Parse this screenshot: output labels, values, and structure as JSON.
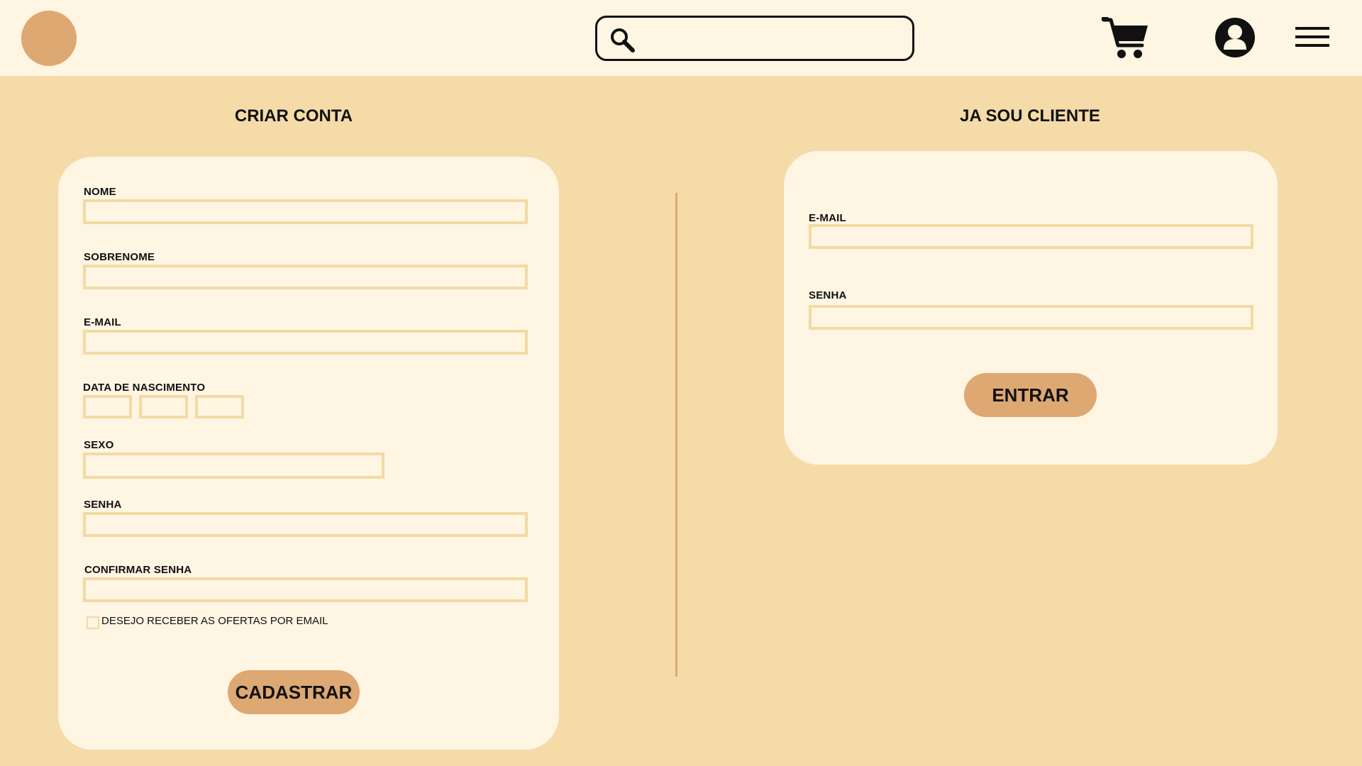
{
  "header": {
    "search": {
      "placeholder": ""
    },
    "icons": [
      "logo-circle",
      "search-icon",
      "cart-icon",
      "user-icon",
      "menu-icon"
    ]
  },
  "register": {
    "title": "CRIAR CONTA",
    "fields": {
      "nome": "NOME",
      "sobrenome": "SOBRENOME",
      "email": "E-MAIL",
      "nascimento": "DATA DE NASCIMENTO",
      "sexo": "SEXO",
      "senha": "SENHA",
      "confirmar": "CONFIRMAR SENHA"
    },
    "newsletter": "DESEJO RECEBER AS OFERTAS POR EMAIL",
    "button": "CADASTRAR"
  },
  "login": {
    "title": "JA SOU CLIENTE",
    "fields": {
      "email": "E-MAIL",
      "senha": "SENHA"
    },
    "button": "ENTRAR"
  },
  "colors": {
    "background": "#f4dba8",
    "card": "#fef5e2",
    "accent": "#dea872",
    "field_border": "#f2daa3"
  }
}
